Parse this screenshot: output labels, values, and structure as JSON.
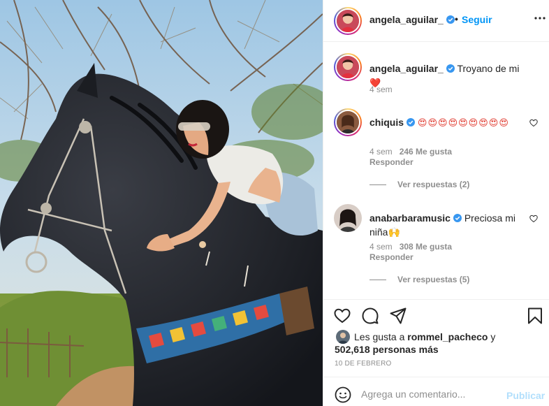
{
  "header": {
    "username": "angela_aguilar_",
    "separator": "•",
    "follow_label": "Seguir",
    "more_icon": "ellipsis-icon"
  },
  "caption": {
    "username": "angela_aguilar_",
    "text": "Troyano de mi",
    "emoji": "❤️",
    "time": "4 sem"
  },
  "comments": [
    {
      "username": "chiquis",
      "text": "😍😍😍😍😍😍😍😍😍",
      "time": "4 sem",
      "likes": "246 Me gusta",
      "reply_label": "Responder",
      "view_replies": "Ver respuestas (2)"
    },
    {
      "username": "anabarbaramusic",
      "text": "Preciosa mi niña🙌",
      "time": "4 sem",
      "likes": "308 Me gusta",
      "reply_label": "Responder",
      "view_replies": "Ver respuestas (5)"
    }
  ],
  "likes": {
    "prefix": "Les gusta a ",
    "user": "rommel_pacheco",
    "connector": " y",
    "others": "502,618 personas más"
  },
  "date": "10 DE FEBRERO",
  "add_comment": {
    "placeholder": "Agrega un comentario...",
    "post_label": "Publicar"
  },
  "colors": {
    "accent": "#0095f6",
    "verified": "#3897f0",
    "text": "#262626",
    "muted": "#8e8e8e",
    "post_disabled": "#b2dffc"
  }
}
